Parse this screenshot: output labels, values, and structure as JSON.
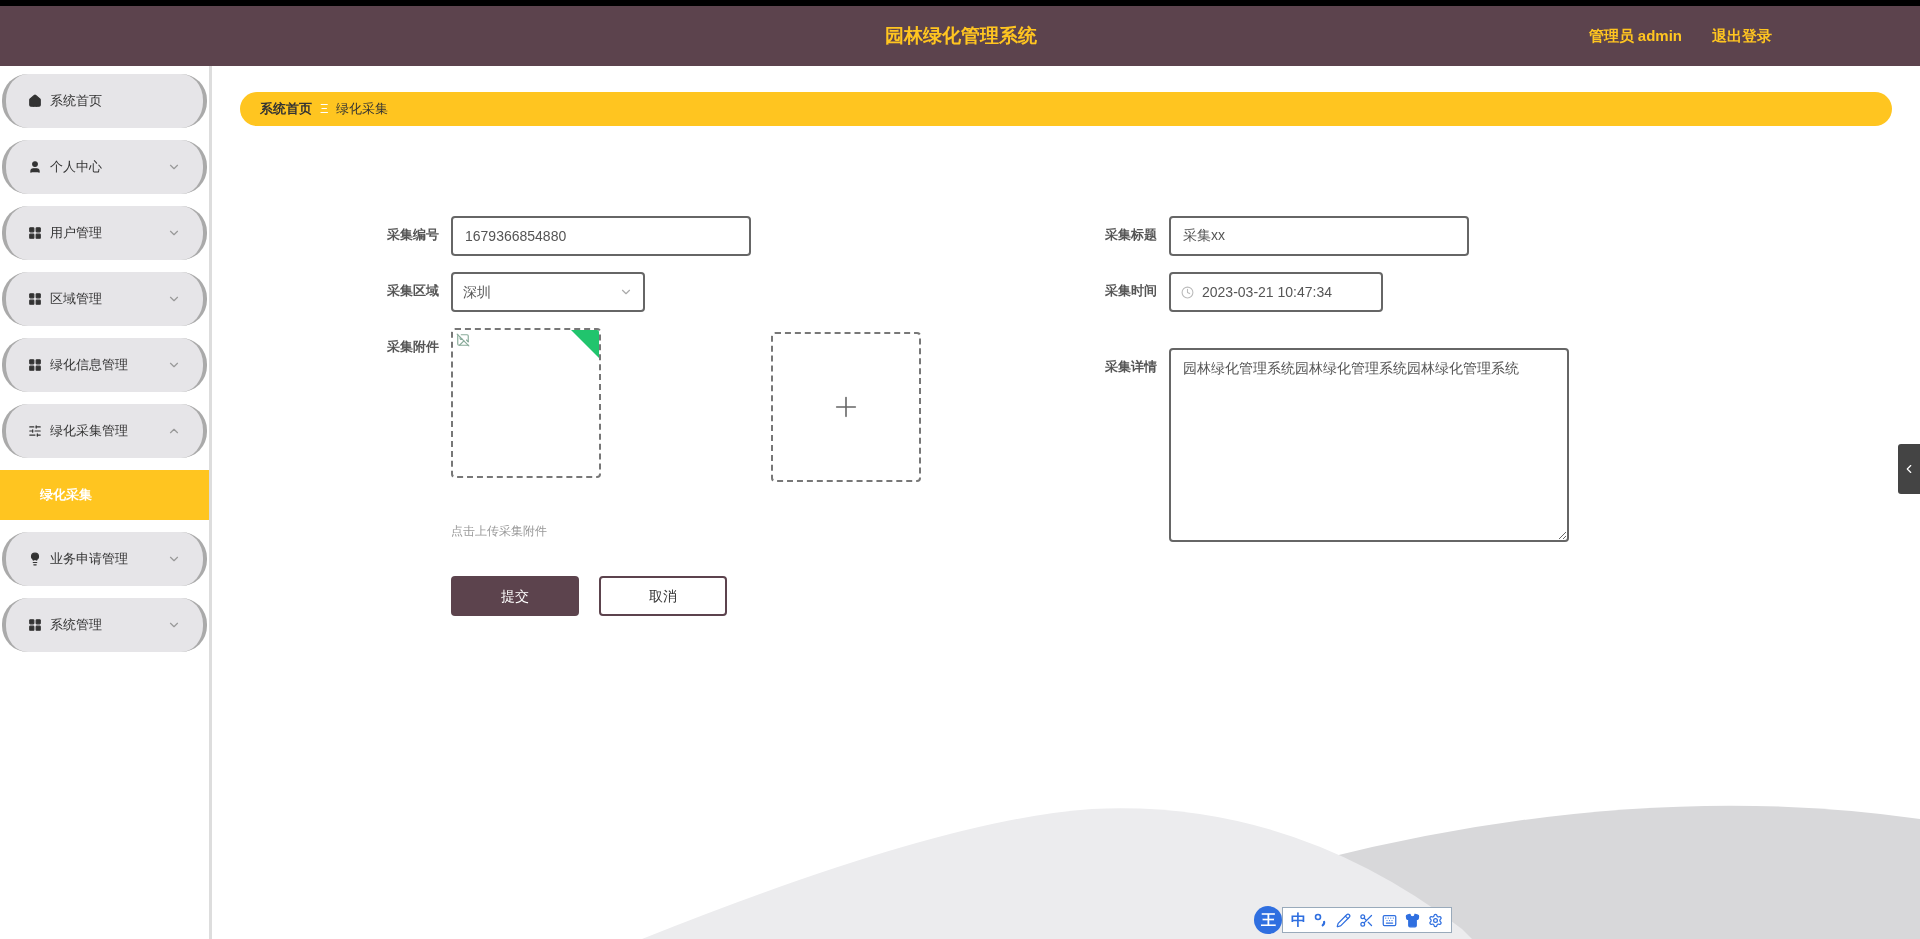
{
  "header": {
    "title": "园林绿化管理系统",
    "user": "管理员 admin",
    "logout": "退出登录"
  },
  "sidebar": {
    "items": [
      {
        "label": "系统首页",
        "kind": "home"
      },
      {
        "label": "个人中心",
        "kind": "user",
        "expanded": false
      },
      {
        "label": "用户管理",
        "kind": "grid",
        "expanded": false
      },
      {
        "label": "区域管理",
        "kind": "grid",
        "expanded": false
      },
      {
        "label": "绿化信息管理",
        "kind": "grid",
        "expanded": false
      },
      {
        "label": "绿化采集管理",
        "kind": "sliders",
        "expanded": true,
        "children": [
          {
            "label": "绿化采集",
            "selected": true
          }
        ]
      },
      {
        "label": "业务申请管理",
        "kind": "bulb",
        "expanded": false
      },
      {
        "label": "系统管理",
        "kind": "grid",
        "expanded": false
      }
    ]
  },
  "breadcrumb": {
    "items": [
      "系统首页",
      "绿化采集"
    ],
    "separator": "Ξ"
  },
  "form": {
    "left": [
      {
        "kind": "text",
        "label": "采集编号",
        "value": "1679366854880"
      },
      {
        "kind": "select",
        "label": "采集区域",
        "value": "深圳"
      },
      {
        "kind": "upload",
        "label": "采集附件",
        "hint": "点击上传采集附件"
      }
    ],
    "right": [
      {
        "kind": "text",
        "label": "采集标题",
        "value": "采集xx"
      },
      {
        "kind": "datetime",
        "label": "采集时间",
        "value": "2023-03-21 10:47:34"
      },
      {
        "kind": "textarea",
        "label": "采集详情",
        "value": "园林绿化管理系统园林绿化管理系统园林绿化管理系统"
      }
    ],
    "buttons": [
      {
        "label": "提交",
        "kind": "primary"
      },
      {
        "label": "取消",
        "kind": "secondary"
      }
    ]
  },
  "ime_toolbar": {
    "logo": "王",
    "mode": "中"
  }
}
